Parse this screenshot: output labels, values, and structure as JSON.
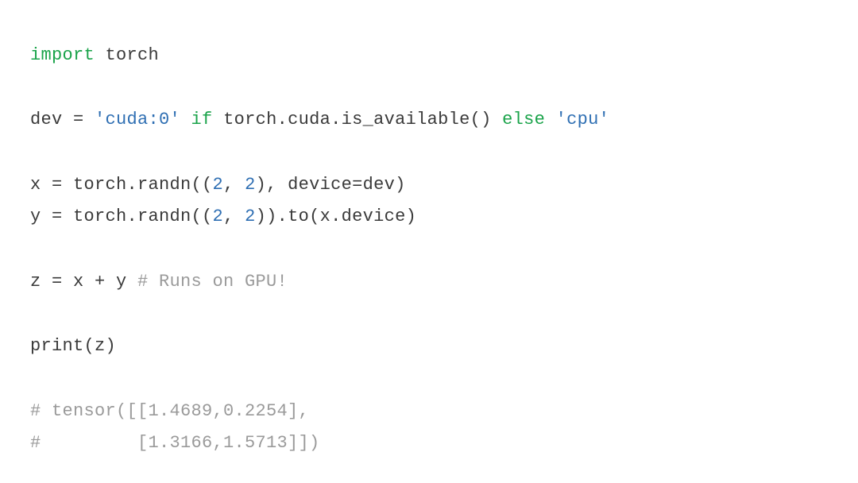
{
  "code": {
    "line1": {
      "import": "import",
      "module": " torch"
    },
    "line2": {
      "var": "dev = ",
      "str1": "'cuda:0'",
      "if": " if",
      "expr": " torch.cuda.is_available() ",
      "else": "else",
      "str2": " 'cpu'"
    },
    "line3": {
      "lhs": "x = torch.randn((",
      "n1": "2",
      "sep1": ", ",
      "n2": "2",
      "mid": "), device=dev)"
    },
    "line4": {
      "lhs": "y = torch.randn((",
      "n1": "2",
      "sep1": ", ",
      "n2": "2",
      "mid": ")).to(x.device)"
    },
    "line5": {
      "expr": "z = x + y ",
      "comment": "# Runs on GPU!"
    },
    "line6": {
      "expr": "print(z)"
    },
    "line7": {
      "comment": "# tensor([[1.4689,0.2254],"
    },
    "line8": {
      "comment": "#         [1.3166,1.5713]])"
    }
  }
}
